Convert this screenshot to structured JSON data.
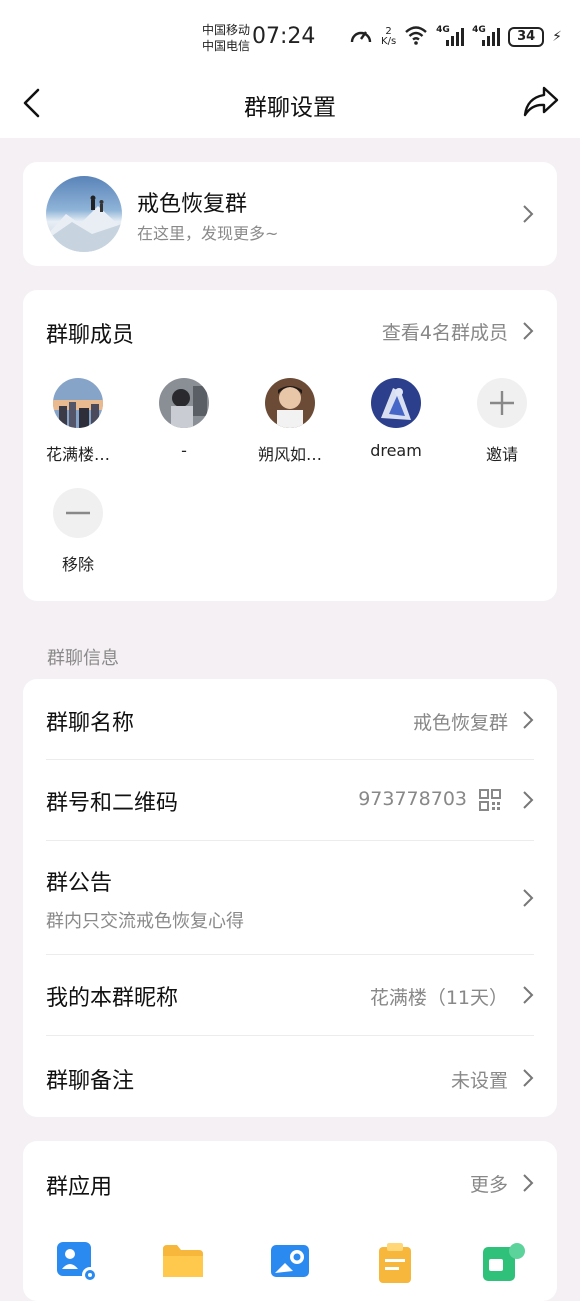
{
  "status_bar": {
    "carrier_1": "中国移动",
    "carrier_2": "中国电信",
    "time": "07:24",
    "net_speed_value": "2",
    "net_speed_unit": "K/s",
    "signal_1_label": "4G",
    "signal_2_label": "4G",
    "battery": "34"
  },
  "header": {
    "title": "群聊设置"
  },
  "group": {
    "name": "戒色恢复群",
    "subtitle": "在这里，发现更多~"
  },
  "members": {
    "title": "群聊成员",
    "view_all": "查看4名群成员",
    "list": [
      {
        "name": "花满楼…"
      },
      {
        "name": "-"
      },
      {
        "name": "朔风如…"
      },
      {
        "name": "dream"
      }
    ],
    "invite_label": "邀请",
    "remove_label": "移除"
  },
  "info": {
    "section_label": "群聊信息",
    "group_name_label": "群聊名称",
    "group_name_value": "戒色恢复群",
    "group_number_label": "群号和二维码",
    "group_number_value": "973778703",
    "announcement_label": "群公告",
    "announcement_value": "群内只交流戒色恢复心得",
    "nickname_label": "我的本群昵称",
    "nickname_value": "花满楼（11天）",
    "remark_label": "群聊备注",
    "remark_value": "未设置"
  },
  "apps": {
    "title": "群应用",
    "more": "更多"
  },
  "colors": {
    "background": "#f5f0f4",
    "card": "#ffffff",
    "secondary_text": "#888888",
    "app_blue": "#2b8af0",
    "app_yellow": "#f6b73c",
    "app_green": "#2fc07a"
  }
}
